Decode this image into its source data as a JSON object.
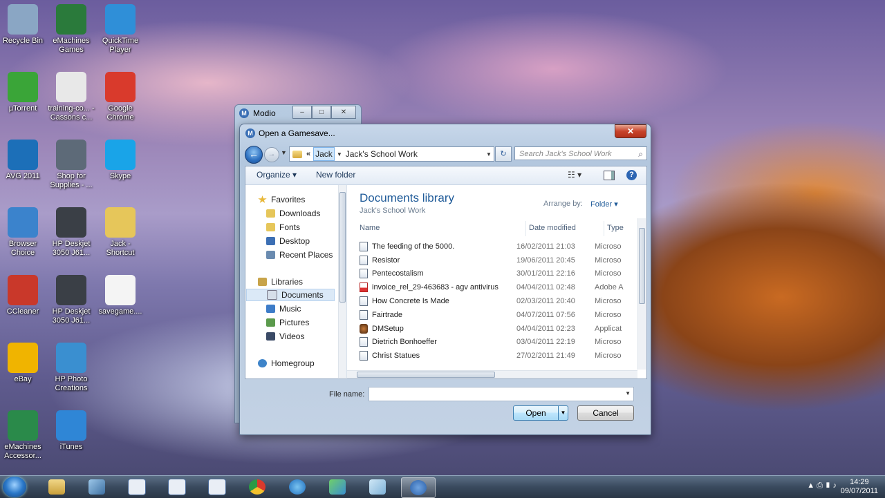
{
  "desktop": {
    "icons": [
      {
        "label": "Recycle Bin",
        "icon": "recycle-bin-icon",
        "color": "#8aa6c4"
      },
      {
        "label": "eMachines Games",
        "icon": "emachines-games-icon",
        "color": "#2a7a3b"
      },
      {
        "label": "QuickTime Player",
        "icon": "quicktime-icon",
        "color": "#2f8fd8"
      },
      {
        "label": "µTorrent",
        "icon": "utorrent-icon",
        "color": "#3aa538"
      },
      {
        "label": "training-co... -Cassons c...",
        "icon": "pdf-document-icon",
        "color": "#e8e8e8"
      },
      {
        "label": "Google Chrome",
        "icon": "chrome-icon",
        "color": "#d93a2c"
      },
      {
        "label": "AVG 2011",
        "icon": "avg-icon",
        "color": "#1c6fb8"
      },
      {
        "label": "Shop for Supplies - ...",
        "icon": "printer-icon",
        "color": "#5d6a78"
      },
      {
        "label": "Skype",
        "icon": "skype-icon",
        "color": "#19a4e8"
      },
      {
        "label": "Browser Choice",
        "icon": "browser-choice-icon",
        "color": "#3b83cc"
      },
      {
        "label": "HP Deskjet 3050 J61...",
        "icon": "scanner-icon",
        "color": "#3a3f46"
      },
      {
        "label": "Jack - Shortcut",
        "icon": "folder-icon",
        "color": "#e6c65a"
      },
      {
        "label": "CCleaner",
        "icon": "ccleaner-icon",
        "color": "#c9382a"
      },
      {
        "label": "HP Deskjet 3050 J61...",
        "icon": "scanner-icon",
        "color": "#3a3f46"
      },
      {
        "label": "savegame....",
        "icon": "file-icon",
        "color": "#f4f4f4"
      },
      {
        "label": "eBay",
        "icon": "ebay-icon",
        "color": "#f0b400"
      },
      {
        "label": "HP Photo Creations",
        "icon": "photo-creations-icon",
        "color": "#3a8fd0"
      },
      {
        "label": "eMachines Accessor...",
        "icon": "emachines-accessories-icon",
        "color": "#2a8a4a"
      },
      {
        "label": "iTunes",
        "icon": "itunes-icon",
        "color": "#2f86d6"
      }
    ]
  },
  "back_window": {
    "title": "Modio",
    "minimize": "–",
    "maximize": "□",
    "close": "✕"
  },
  "dialog": {
    "title": "Open a Gamesave...",
    "close": "✕",
    "nav": {
      "back": "←",
      "forward": "→",
      "chevron": "«",
      "crumb1": "Jack",
      "crumb_sep": "▼",
      "crumb2": "Jack's School Work",
      "dropdown": "▼",
      "refresh": "↻",
      "search_placeholder": "Search Jack's School Work",
      "search_icon": "⌕"
    },
    "toolbar": {
      "organize": "Organize ▾",
      "new_folder": "New folder",
      "views": "☷ ▾",
      "help": "?"
    },
    "navpane": {
      "favorites": "Favorites",
      "downloads": "Downloads",
      "fonts": "Fonts",
      "desktop": "Desktop",
      "recent_places": "Recent Places",
      "libraries": "Libraries",
      "documents": "Documents",
      "music": "Music",
      "pictures": "Pictures",
      "videos": "Videos",
      "homegroup": "Homegroup"
    },
    "library": {
      "title": "Documents library",
      "subtitle": "Jack's School Work",
      "arrange_label": "Arrange by:",
      "arrange_value": "Folder ▾"
    },
    "columns": {
      "name": "Name",
      "date": "Date modified",
      "type": "Type"
    },
    "files": [
      {
        "name": "The feeding of the 5000.",
        "date": "16/02/2011 21:03",
        "type": "Microso",
        "kind": "doc"
      },
      {
        "name": "Resistor",
        "date": "19/06/2011 20:45",
        "type": "Microso",
        "kind": "doc"
      },
      {
        "name": "Pentecostalism",
        "date": "30/01/2011 22:16",
        "type": "Microso",
        "kind": "doc"
      },
      {
        "name": "invoice_rel_29-463683 - agv antivirus",
        "date": "04/04/2011 02:48",
        "type": "Adobe A",
        "kind": "pdf"
      },
      {
        "name": "How Concrete Is Made",
        "date": "02/03/2011 20:40",
        "type": "Microso",
        "kind": "doc"
      },
      {
        "name": "Fairtrade",
        "date": "04/07/2011 07:56",
        "type": "Microso",
        "kind": "doc"
      },
      {
        "name": "DMSetup",
        "date": "04/04/2011 02:23",
        "type": "Applicat",
        "kind": "exe"
      },
      {
        "name": "Dietrich Bonhoeffer",
        "date": "03/04/2011 22:19",
        "type": "Microso",
        "kind": "doc"
      },
      {
        "name": "Christ Statues",
        "date": "27/02/2011 21:49",
        "type": "Microso",
        "kind": "doc"
      }
    ],
    "file_name_label": "File name:",
    "file_name_value": "",
    "open_label": "Open",
    "cancel_label": "Cancel"
  },
  "taskbar": {
    "clock_time": "14:29",
    "clock_date": "09/07/2011",
    "tray": "▲ ⎙ ▮ ♪"
  }
}
